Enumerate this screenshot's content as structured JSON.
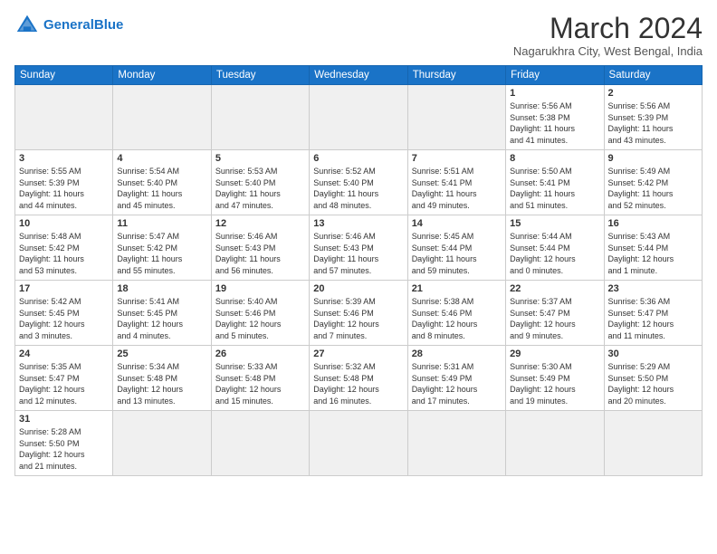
{
  "header": {
    "logo_general": "General",
    "logo_blue": "Blue",
    "month_title": "March 2024",
    "location": "Nagarukhra City, West Bengal, India"
  },
  "weekdays": [
    "Sunday",
    "Monday",
    "Tuesday",
    "Wednesday",
    "Thursday",
    "Friday",
    "Saturday"
  ],
  "weeks": [
    [
      {
        "day": "",
        "info": ""
      },
      {
        "day": "",
        "info": ""
      },
      {
        "day": "",
        "info": ""
      },
      {
        "day": "",
        "info": ""
      },
      {
        "day": "",
        "info": ""
      },
      {
        "day": "1",
        "info": "Sunrise: 5:56 AM\nSunset: 5:38 PM\nDaylight: 11 hours\nand 41 minutes."
      },
      {
        "day": "2",
        "info": "Sunrise: 5:56 AM\nSunset: 5:39 PM\nDaylight: 11 hours\nand 43 minutes."
      }
    ],
    [
      {
        "day": "3",
        "info": "Sunrise: 5:55 AM\nSunset: 5:39 PM\nDaylight: 11 hours\nand 44 minutes."
      },
      {
        "day": "4",
        "info": "Sunrise: 5:54 AM\nSunset: 5:40 PM\nDaylight: 11 hours\nand 45 minutes."
      },
      {
        "day": "5",
        "info": "Sunrise: 5:53 AM\nSunset: 5:40 PM\nDaylight: 11 hours\nand 47 minutes."
      },
      {
        "day": "6",
        "info": "Sunrise: 5:52 AM\nSunset: 5:40 PM\nDaylight: 11 hours\nand 48 minutes."
      },
      {
        "day": "7",
        "info": "Sunrise: 5:51 AM\nSunset: 5:41 PM\nDaylight: 11 hours\nand 49 minutes."
      },
      {
        "day": "8",
        "info": "Sunrise: 5:50 AM\nSunset: 5:41 PM\nDaylight: 11 hours\nand 51 minutes."
      },
      {
        "day": "9",
        "info": "Sunrise: 5:49 AM\nSunset: 5:42 PM\nDaylight: 11 hours\nand 52 minutes."
      }
    ],
    [
      {
        "day": "10",
        "info": "Sunrise: 5:48 AM\nSunset: 5:42 PM\nDaylight: 11 hours\nand 53 minutes."
      },
      {
        "day": "11",
        "info": "Sunrise: 5:47 AM\nSunset: 5:42 PM\nDaylight: 11 hours\nand 55 minutes."
      },
      {
        "day": "12",
        "info": "Sunrise: 5:46 AM\nSunset: 5:43 PM\nDaylight: 11 hours\nand 56 minutes."
      },
      {
        "day": "13",
        "info": "Sunrise: 5:46 AM\nSunset: 5:43 PM\nDaylight: 11 hours\nand 57 minutes."
      },
      {
        "day": "14",
        "info": "Sunrise: 5:45 AM\nSunset: 5:44 PM\nDaylight: 11 hours\nand 59 minutes."
      },
      {
        "day": "15",
        "info": "Sunrise: 5:44 AM\nSunset: 5:44 PM\nDaylight: 12 hours\nand 0 minutes."
      },
      {
        "day": "16",
        "info": "Sunrise: 5:43 AM\nSunset: 5:44 PM\nDaylight: 12 hours\nand 1 minute."
      }
    ],
    [
      {
        "day": "17",
        "info": "Sunrise: 5:42 AM\nSunset: 5:45 PM\nDaylight: 12 hours\nand 3 minutes."
      },
      {
        "day": "18",
        "info": "Sunrise: 5:41 AM\nSunset: 5:45 PM\nDaylight: 12 hours\nand 4 minutes."
      },
      {
        "day": "19",
        "info": "Sunrise: 5:40 AM\nSunset: 5:46 PM\nDaylight: 12 hours\nand 5 minutes."
      },
      {
        "day": "20",
        "info": "Sunrise: 5:39 AM\nSunset: 5:46 PM\nDaylight: 12 hours\nand 7 minutes."
      },
      {
        "day": "21",
        "info": "Sunrise: 5:38 AM\nSunset: 5:46 PM\nDaylight: 12 hours\nand 8 minutes."
      },
      {
        "day": "22",
        "info": "Sunrise: 5:37 AM\nSunset: 5:47 PM\nDaylight: 12 hours\nand 9 minutes."
      },
      {
        "day": "23",
        "info": "Sunrise: 5:36 AM\nSunset: 5:47 PM\nDaylight: 12 hours\nand 11 minutes."
      }
    ],
    [
      {
        "day": "24",
        "info": "Sunrise: 5:35 AM\nSunset: 5:47 PM\nDaylight: 12 hours\nand 12 minutes."
      },
      {
        "day": "25",
        "info": "Sunrise: 5:34 AM\nSunset: 5:48 PM\nDaylight: 12 hours\nand 13 minutes."
      },
      {
        "day": "26",
        "info": "Sunrise: 5:33 AM\nSunset: 5:48 PM\nDaylight: 12 hours\nand 15 minutes."
      },
      {
        "day": "27",
        "info": "Sunrise: 5:32 AM\nSunset: 5:48 PM\nDaylight: 12 hours\nand 16 minutes."
      },
      {
        "day": "28",
        "info": "Sunrise: 5:31 AM\nSunset: 5:49 PM\nDaylight: 12 hours\nand 17 minutes."
      },
      {
        "day": "29",
        "info": "Sunrise: 5:30 AM\nSunset: 5:49 PM\nDaylight: 12 hours\nand 19 minutes."
      },
      {
        "day": "30",
        "info": "Sunrise: 5:29 AM\nSunset: 5:50 PM\nDaylight: 12 hours\nand 20 minutes."
      }
    ],
    [
      {
        "day": "31",
        "info": "Sunrise: 5:28 AM\nSunset: 5:50 PM\nDaylight: 12 hours\nand 21 minutes."
      },
      {
        "day": "",
        "info": ""
      },
      {
        "day": "",
        "info": ""
      },
      {
        "day": "",
        "info": ""
      },
      {
        "day": "",
        "info": ""
      },
      {
        "day": "",
        "info": ""
      },
      {
        "day": "",
        "info": ""
      }
    ]
  ]
}
